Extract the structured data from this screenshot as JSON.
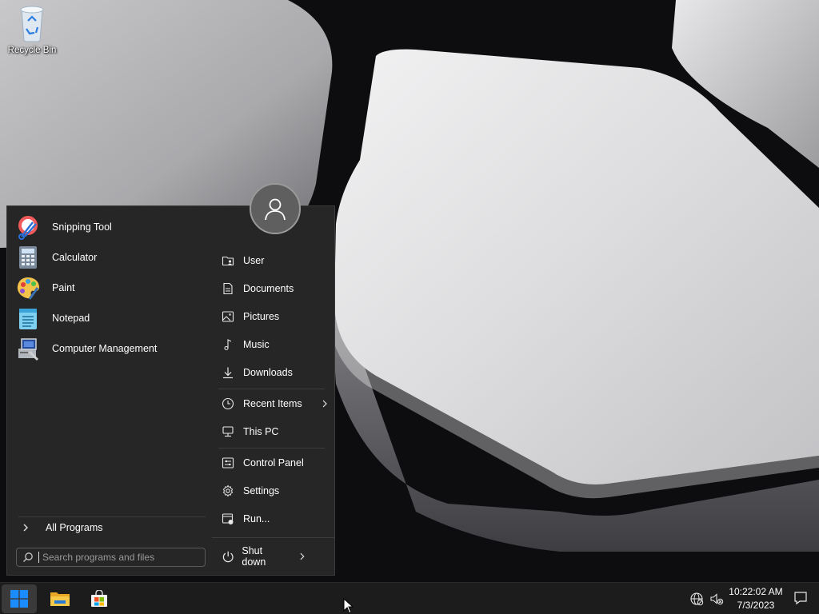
{
  "desktop": {
    "icons": [
      {
        "label": "Recycle Bin",
        "icon": "recycle-bin-icon"
      }
    ]
  },
  "start_menu": {
    "user_avatar": "user-avatar-icon",
    "pinned_apps": [
      {
        "label": "Snipping Tool",
        "icon": "snipping-tool-icon"
      },
      {
        "label": "Calculator",
        "icon": "calculator-icon"
      },
      {
        "label": "Paint",
        "icon": "paint-icon"
      },
      {
        "label": "Notepad",
        "icon": "notepad-icon"
      },
      {
        "label": "Computer Management",
        "icon": "computer-management-icon"
      }
    ],
    "all_programs": "All Programs",
    "search": {
      "placeholder": "Search programs and files",
      "value": ""
    },
    "right_items": [
      {
        "label": "User",
        "icon": "user-folder-icon"
      },
      {
        "label": "Documents",
        "icon": "document-icon"
      },
      {
        "label": "Pictures",
        "icon": "picture-icon"
      },
      {
        "label": "Music",
        "icon": "music-note-icon"
      },
      {
        "label": "Downloads",
        "icon": "download-arrow-icon"
      },
      {
        "label": "Recent Items",
        "icon": "clock-icon",
        "has_submenu": true
      },
      {
        "label": "This PC",
        "icon": "computer-icon"
      },
      {
        "label": "Control Panel",
        "icon": "control-panel-icon"
      },
      {
        "label": "Settings",
        "icon": "gear-icon"
      },
      {
        "label": "Run...",
        "icon": "run-icon"
      }
    ],
    "shutdown": "Shut down"
  },
  "taskbar": {
    "pinned": [
      {
        "name": "Start",
        "icon": "windows-logo-icon"
      },
      {
        "name": "File Explorer",
        "icon": "folder-icon"
      },
      {
        "name": "Microsoft Store",
        "icon": "store-bag-icon"
      }
    ],
    "tray": {
      "icons": [
        "network-globe-icon",
        "speaker-muted-icon"
      ],
      "time": "10:22:02 AM",
      "date": "7/3/2023",
      "notification_icon": "notification-icon"
    }
  },
  "colors": {
    "menu_background": "#262626",
    "taskbar_background": "#1c1c1c",
    "accent": "#1a8cff"
  }
}
